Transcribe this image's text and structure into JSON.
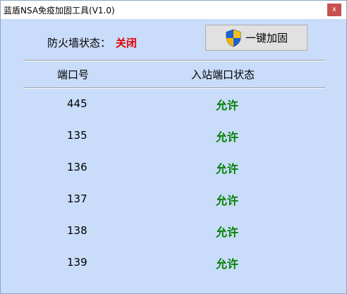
{
  "window": {
    "title": "蓝盾NSA免疫加固工具(V1.0)",
    "close_label": "x"
  },
  "firewall": {
    "label": "防火墙状态：",
    "value": "关闭",
    "value_color": "#e00000"
  },
  "harden_button": {
    "label": "一键加固",
    "icon": "uac-shield-icon"
  },
  "table": {
    "headers": {
      "port": "端口号",
      "inbound_status": "入站端口状态"
    },
    "rows": [
      {
        "port": "445",
        "status": "允许"
      },
      {
        "port": "135",
        "status": "允许"
      },
      {
        "port": "136",
        "status": "允许"
      },
      {
        "port": "137",
        "status": "允许"
      },
      {
        "port": "138",
        "status": "允许"
      },
      {
        "port": "139",
        "status": "允许"
      }
    ],
    "status_color": "#008000"
  },
  "colors": {
    "background": "#c9dcf9",
    "titlebar": "#ffffff",
    "close_button": "#c75050"
  }
}
